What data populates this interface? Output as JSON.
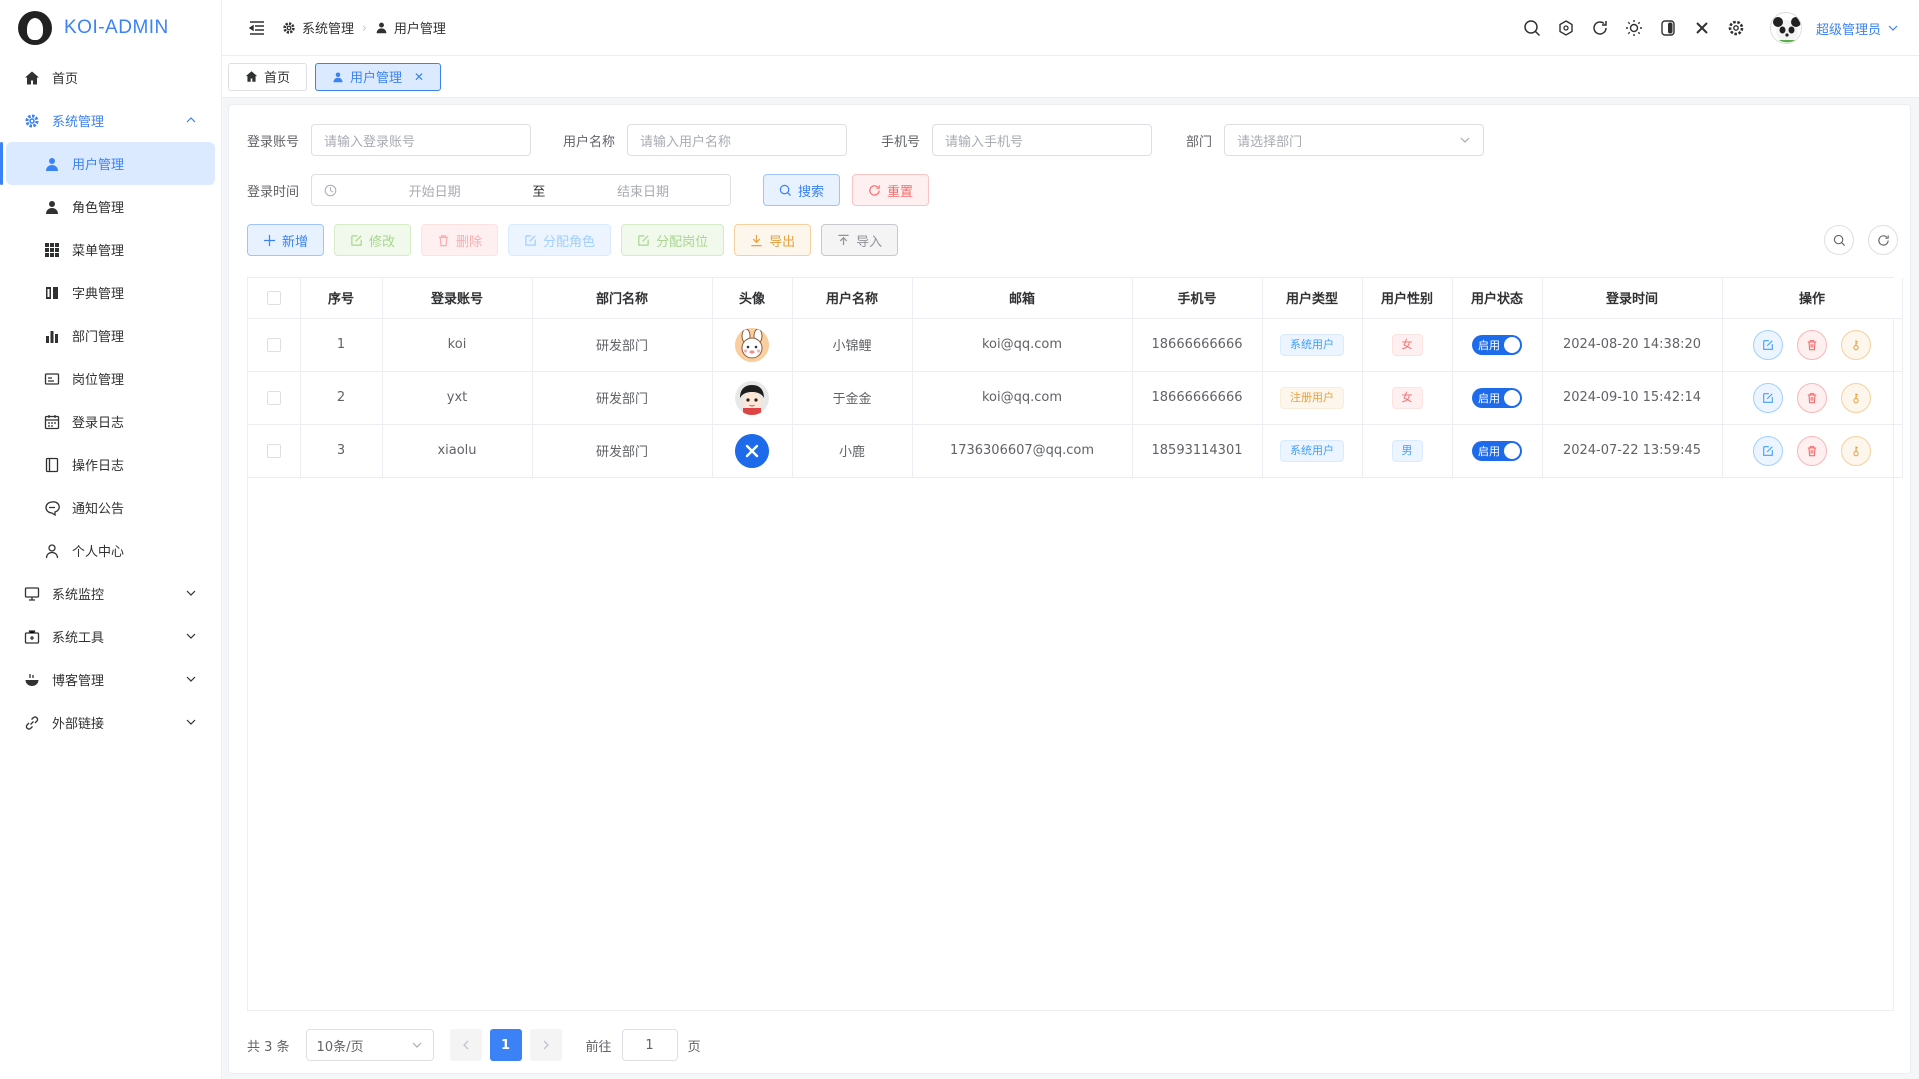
{
  "app": {
    "logo_text": "KOI-ADMIN"
  },
  "sidebar": {
    "items": [
      {
        "label": "首页"
      },
      {
        "label": "系统管理"
      },
      {
        "label": "系统监控"
      },
      {
        "label": "系统工具"
      },
      {
        "label": "博客管理"
      },
      {
        "label": "外部链接"
      }
    ],
    "sub_items": [
      {
        "label": "用户管理"
      },
      {
        "label": "角色管理"
      },
      {
        "label": "菜单管理"
      },
      {
        "label": "字典管理"
      },
      {
        "label": "部门管理"
      },
      {
        "label": "岗位管理"
      },
      {
        "label": "登录日志"
      },
      {
        "label": "操作日志"
      },
      {
        "label": "通知公告"
      },
      {
        "label": "个人中心"
      }
    ]
  },
  "header": {
    "breadcrumb": [
      "系统管理",
      "用户管理"
    ],
    "user_name": "超级管理员"
  },
  "tabs": [
    {
      "label": "首页"
    },
    {
      "label": "用户管理"
    }
  ],
  "search": {
    "login_account_label": "登录账号",
    "login_account_placeholder": "请输入登录账号",
    "user_name_label": "用户名称",
    "user_name_placeholder": "请输入用户名称",
    "phone_label": "手机号",
    "phone_placeholder": "请输入手机号",
    "dept_label": "部门",
    "dept_placeholder": "请选择部门",
    "login_time_label": "登录时间",
    "start_placeholder": "开始日期",
    "range_sep": "至",
    "end_placeholder": "结束日期",
    "search_btn": "搜索",
    "reset_btn": "重置"
  },
  "toolbar": {
    "add": "新增",
    "edit": "修改",
    "delete": "删除",
    "assign_role": "分配角色",
    "assign_post": "分配岗位",
    "export": "导出",
    "import": "导入"
  },
  "table": {
    "headers": [
      "序号",
      "登录账号",
      "部门名称",
      "头像",
      "用户名称",
      "邮箱",
      "手机号",
      "用户类型",
      "用户性别",
      "用户状态",
      "登录时间",
      "操作"
    ],
    "rows": [
      {
        "index": "1",
        "account": "koi",
        "dept": "研发部门",
        "avatar": "bunny-avatar",
        "name": "小锦鲤",
        "email": "koi@qq.com",
        "phone": "18666666666",
        "type": "系统用户",
        "type_style": "primary",
        "sex": "女",
        "sex_style": "danger",
        "status": "启用",
        "login_time": "2024-08-20 14:38:20"
      },
      {
        "index": "2",
        "account": "yxt",
        "dept": "研发部门",
        "avatar": "cartoon-avatar",
        "name": "于金金",
        "email": "koi@qq.com",
        "phone": "18666666666",
        "type": "注册用户",
        "type_style": "warning",
        "sex": "女",
        "sex_style": "danger",
        "status": "启用",
        "login_time": "2024-09-10 15:42:14"
      },
      {
        "index": "3",
        "account": "xiaolu",
        "dept": "研发部门",
        "avatar": "broken-image-avatar",
        "name": "小鹿",
        "email": "1736306607@qq.com",
        "phone": "18593114301",
        "type": "系统用户",
        "type_style": "primary",
        "sex": "男",
        "sex_style": "primary",
        "status": "启用",
        "login_time": "2024-07-22 13:59:45"
      }
    ]
  },
  "pagination": {
    "total": "共 3 条",
    "page_size": "10条/页",
    "current_page": "1",
    "goto_label": "前往",
    "goto_value": "1",
    "page_suffix": "页"
  },
  "colors": {
    "primary": "#3b82f6",
    "switch": "#1d6bea"
  }
}
